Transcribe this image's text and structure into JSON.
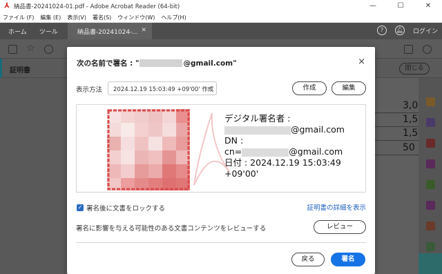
{
  "window": {
    "title": "納品書-20241024-01.pdf - Adobe Acrobat Reader (64-bit)",
    "minimize": "—",
    "maximize": "☐",
    "close": "✕"
  },
  "menubar": {
    "items": [
      "ファイル (F)",
      "編集 (E)",
      "表示(V)",
      "署名(S)",
      "ウィンドウ(W)",
      "ヘルプ(H)"
    ]
  },
  "tabs": {
    "home": "ホーム",
    "tools": "ツール",
    "document": "納品書-20241024-...",
    "help_icon": "?",
    "login": "ログイン"
  },
  "certbar": {
    "label": "証明書",
    "close_button": "閉じる"
  },
  "document_values": [
    "3,0",
    "1,5",
    "1,5",
    "50"
  ],
  "dialog": {
    "title_prefix": "次の名前で署名 : \"",
    "title_suffix": "@gmail.com\"",
    "close": "×",
    "appearance_label": "表示方法",
    "appearance_value": "2024.12.19 15:03:49 +09'00' 作成",
    "create_button": "作成",
    "edit_button": "編集",
    "signature": {
      "line1": "デジタル署名者 :",
      "line2_suffix": "@gmail.com",
      "line3": "DN :",
      "line4_prefix": "cn=",
      "line4_suffix": "@gmail.com",
      "line5": "日付 : 2024.12.19 15:03:49",
      "line6": "+09'00'"
    },
    "lock_label": "署名後に文書をロックする",
    "lock_checked": true,
    "cert_link": "証明書の詳細を表示",
    "review_label": "署名に影響を与える可能性のある文書コンテンツをレビューする",
    "review_button": "レビュー",
    "back_button": "戻る",
    "sign_button": "署名",
    "accent_color": "#1473e6"
  }
}
